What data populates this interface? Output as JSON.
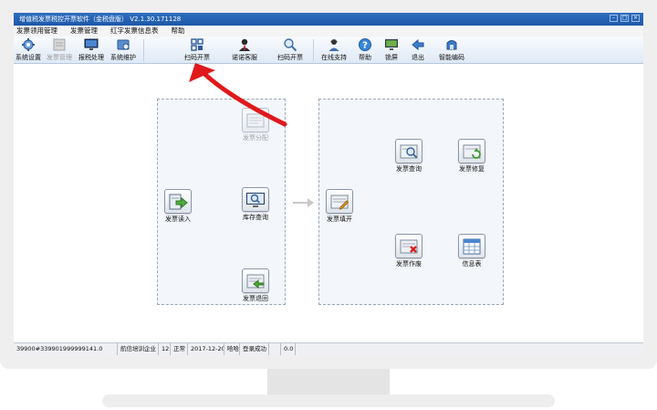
{
  "window": {
    "title": "增值税发票税控开票软件（金税盘版） V2.1.30.171128"
  },
  "menu": [
    "发票领用管理",
    "发票管理",
    "红字发票信息表",
    "帮助"
  ],
  "toolbar": {
    "items": [
      {
        "name": "system-settings",
        "label": "系统设置",
        "icon": "gear-icon",
        "disabled": false
      },
      {
        "name": "invoice-management",
        "label": "发票管理",
        "icon": "invoice-stack-icon",
        "disabled": true
      },
      {
        "name": "tax-reporting",
        "label": "报税处理",
        "icon": "monitor-icon",
        "disabled": false
      },
      {
        "name": "system-maintenance",
        "label": "系统维护",
        "icon": "toolbox-icon",
        "disabled": false
      },
      {
        "name": "scan-issue",
        "label": "扫码开票",
        "icon": "qr-grid-icon",
        "disabled": false
      },
      {
        "name": "nuonuo-service",
        "label": "诺诺客服",
        "icon": "agent-icon",
        "disabled": false
      },
      {
        "name": "scan-invoice",
        "label": "扫码开票",
        "icon": "magnifier-icon",
        "disabled": false
      },
      {
        "name": "online-support",
        "label": "在线支持",
        "icon": "support-person-icon",
        "disabled": false
      },
      {
        "name": "help",
        "label": "帮助",
        "icon": "question-icon",
        "disabled": false
      },
      {
        "name": "lock-screen",
        "label": "锁屏",
        "icon": "lock-monitor-icon",
        "disabled": false
      },
      {
        "name": "exit",
        "label": "退出",
        "icon": "exit-arrow-icon",
        "disabled": false
      },
      {
        "name": "smart-code",
        "label": "智能编码",
        "icon": "smart-code-icon",
        "disabled": false
      }
    ]
  },
  "flow": {
    "left_panel": {
      "read_in": {
        "label": "发票读入",
        "icon": "usb-read-icon",
        "disabled": false
      },
      "distribute": {
        "label": "发票分配",
        "icon": "invoice-distribute-icon",
        "disabled": true
      },
      "stock_query": {
        "label": "库存查询",
        "icon": "stock-query-icon",
        "disabled": false
      },
      "return": {
        "label": "发票退回",
        "icon": "invoice-return-icon",
        "disabled": false
      }
    },
    "right_panel": {
      "fill_issue": {
        "label": "发票填开",
        "icon": "invoice-fill-icon",
        "disabled": false
      },
      "query": {
        "label": "发票查询",
        "icon": "invoice-query-icon",
        "disabled": false
      },
      "repair": {
        "label": "发票修复",
        "icon": "invoice-repair-icon",
        "disabled": false
      },
      "void": {
        "label": "发票作废",
        "icon": "invoice-void-icon",
        "disabled": false
      },
      "info_table": {
        "label": "信息表",
        "icon": "info-table-icon",
        "disabled": false
      }
    }
  },
  "status": [
    "39900#339901999999141.0",
    "航信培训企业",
    "12",
    "正常",
    "2017-12-20",
    "哈哈",
    "登录成功",
    "",
    "0.0"
  ],
  "colors": {
    "annotation_arrow": "#e0191c",
    "title_bar": "#1d58a8",
    "panel_bg": "#f3f6fb"
  }
}
